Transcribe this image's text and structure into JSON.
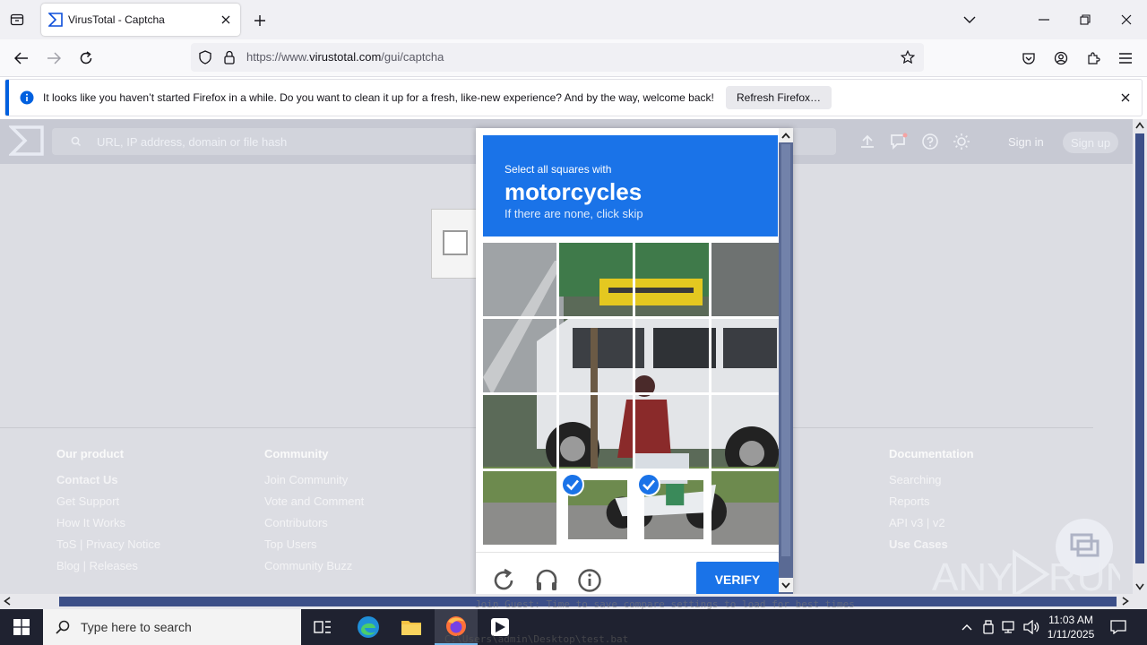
{
  "browser": {
    "tab_title": "VirusTotal - Captcha",
    "url_prefix": "https://www.",
    "url_host": "virustotal.com",
    "url_path": "/gui/captcha"
  },
  "notification": {
    "message": "It looks like you haven’t started Firefox in a while. Do you want to clean it up for a fresh, like-new experience? And by the way, welcome back!",
    "button": "Refresh Firefox…"
  },
  "vt": {
    "search_placeholder": "URL, IP address, domain or file hash",
    "sign_in": "Sign in",
    "sign_up": "Sign up"
  },
  "footer": {
    "columns": [
      {
        "heading": "Our product",
        "links": [
          "Contact Us",
          "Get Support",
          "How It Works",
          "ToS | Privacy Notice",
          "Blog | Releases"
        ]
      },
      {
        "heading": "Community",
        "links": [
          "Join Community",
          "Vote and Comment",
          "Contributors",
          "Top Users",
          "Community Buzz"
        ]
      },
      {
        "heading": "Documentation",
        "links": [
          "Searching",
          "Reports",
          "API v3 | v2",
          "Use Cases"
        ]
      }
    ]
  },
  "captcha": {
    "instruction": "Select all squares with",
    "target": "motorcycles",
    "hint": "If there are none, click skip",
    "verify": "VERIFY",
    "selected_tiles": [
      13,
      14
    ]
  },
  "watermark": "ANY RUN",
  "taskbar": {
    "search_placeholder": "Type here to search",
    "time": "11:03 AM",
    "date": "1/11/2025",
    "terminal_line": "Join Guest: Time to save compare settings to load for best times",
    "terminal_path": "C:\\Users\\admin\\Desktop\\test.bat"
  },
  "colors": {
    "accent": "#1a73e8",
    "firefox_blue": "#0060df",
    "vt_scrollbar": "#3c4f88"
  }
}
